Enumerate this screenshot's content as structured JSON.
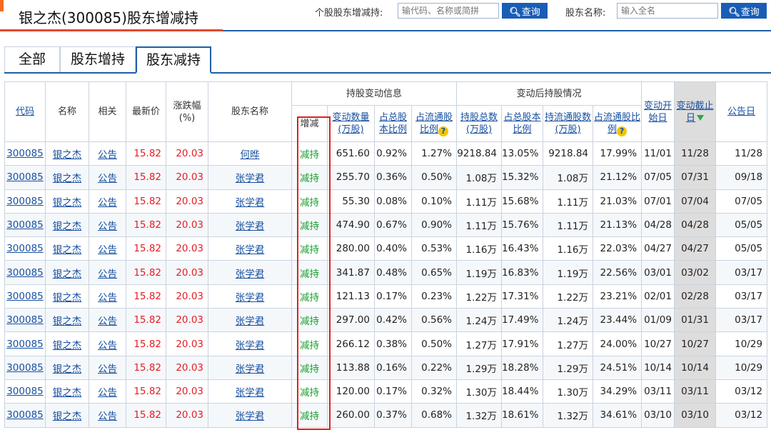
{
  "header": {
    "title": "银之杰(300085)股东增减持",
    "search1_label": "个股股东增减持:",
    "search1_placeholder": "输代码、名称或简拼",
    "search1_button": "查询",
    "search2_label": "股东名称:",
    "search2_placeholder": "输入全名",
    "search2_button": "查询",
    "accent_color": "#e04a2a",
    "brand_blue": "#1f5fa6"
  },
  "tabs": [
    {
      "label": "全部",
      "active": false
    },
    {
      "label": "股东增持",
      "active": false
    },
    {
      "label": "股东减持",
      "active": true
    }
  ],
  "table": {
    "headers": {
      "code": "代码",
      "name": "名称",
      "related": "相关",
      "price": "最新价",
      "change": "涨跌幅(%)",
      "holder": "股东名称",
      "group1": "持股变动信息",
      "group2": "变动后持股情况",
      "direction": "增减",
      "change_qty": "变动数量(万股)",
      "total_ratio": "占总股本比例",
      "float_ratio": "占流通股比例",
      "hold_total": "持股总数(万股)",
      "hold_total_ratio": "占总股本比例",
      "hold_float": "持流通股数(万股)",
      "hold_float_ratio": "占流通股比例",
      "start": "变动开始日",
      "end": "变动截止日",
      "notice": "公告日"
    },
    "rows": [
      {
        "code": "300085",
        "name": "银之杰",
        "related": "公告",
        "price": "15.82",
        "change": "20.03",
        "holder": "何晔",
        "dir": "减持",
        "qty": "651.60",
        "r1": "0.92%",
        "r2": "1.27%",
        "total": "9218.84",
        "r3": "13.05%",
        "float": "9218.84",
        "r4": "17.99%",
        "start": "11/01",
        "end": "11/28",
        "notice": "11/28"
      },
      {
        "code": "300085",
        "name": "银之杰",
        "related": "公告",
        "price": "15.82",
        "change": "20.03",
        "holder": "张学君",
        "dir": "减持",
        "qty": "255.70",
        "r1": "0.36%",
        "r2": "0.50%",
        "total": "1.08万",
        "r3": "15.32%",
        "float": "1.08万",
        "r4": "21.12%",
        "start": "07/05",
        "end": "07/31",
        "notice": "09/18"
      },
      {
        "code": "300085",
        "name": "银之杰",
        "related": "公告",
        "price": "15.82",
        "change": "20.03",
        "holder": "张学君",
        "dir": "减持",
        "qty": "55.30",
        "r1": "0.08%",
        "r2": "0.10%",
        "total": "1.11万",
        "r3": "15.68%",
        "float": "1.11万",
        "r4": "21.03%",
        "start": "07/01",
        "end": "07/04",
        "notice": "07/05"
      },
      {
        "code": "300085",
        "name": "银之杰",
        "related": "公告",
        "price": "15.82",
        "change": "20.03",
        "holder": "张学君",
        "dir": "减持",
        "qty": "474.90",
        "r1": "0.67%",
        "r2": "0.90%",
        "total": "1.11万",
        "r3": "15.76%",
        "float": "1.11万",
        "r4": "21.13%",
        "start": "04/28",
        "end": "04/28",
        "notice": "05/05"
      },
      {
        "code": "300085",
        "name": "银之杰",
        "related": "公告",
        "price": "15.82",
        "change": "20.03",
        "holder": "张学君",
        "dir": "减持",
        "qty": "280.00",
        "r1": "0.40%",
        "r2": "0.53%",
        "total": "1.16万",
        "r3": "16.43%",
        "float": "1.16万",
        "r4": "22.03%",
        "start": "04/27",
        "end": "04/27",
        "notice": "05/05"
      },
      {
        "code": "300085",
        "name": "银之杰",
        "related": "公告",
        "price": "15.82",
        "change": "20.03",
        "holder": "张学君",
        "dir": "减持",
        "qty": "341.87",
        "r1": "0.48%",
        "r2": "0.65%",
        "total": "1.19万",
        "r3": "16.83%",
        "float": "1.19万",
        "r4": "22.56%",
        "start": "03/01",
        "end": "03/02",
        "notice": "03/17"
      },
      {
        "code": "300085",
        "name": "银之杰",
        "related": "公告",
        "price": "15.82",
        "change": "20.03",
        "holder": "张学君",
        "dir": "减持",
        "qty": "121.13",
        "r1": "0.17%",
        "r2": "0.23%",
        "total": "1.22万",
        "r3": "17.31%",
        "float": "1.22万",
        "r4": "23.21%",
        "start": "02/01",
        "end": "02/28",
        "notice": "03/17"
      },
      {
        "code": "300085",
        "name": "银之杰",
        "related": "公告",
        "price": "15.82",
        "change": "20.03",
        "holder": "张学君",
        "dir": "减持",
        "qty": "297.00",
        "r1": "0.42%",
        "r2": "0.56%",
        "total": "1.24万",
        "r3": "17.49%",
        "float": "1.24万",
        "r4": "23.44%",
        "start": "01/09",
        "end": "01/31",
        "notice": "03/17"
      },
      {
        "code": "300085",
        "name": "银之杰",
        "related": "公告",
        "price": "15.82",
        "change": "20.03",
        "holder": "张学君",
        "dir": "减持",
        "qty": "266.12",
        "r1": "0.38%",
        "r2": "0.50%",
        "total": "1.27万",
        "r3": "17.91%",
        "float": "1.27万",
        "r4": "24.00%",
        "start": "10/27",
        "end": "10/27",
        "notice": "10/29"
      },
      {
        "code": "300085",
        "name": "银之杰",
        "related": "公告",
        "price": "15.82",
        "change": "20.03",
        "holder": "张学君",
        "dir": "减持",
        "qty": "113.88",
        "r1": "0.16%",
        "r2": "0.22%",
        "total": "1.29万",
        "r3": "18.28%",
        "float": "1.29万",
        "r4": "24.51%",
        "start": "10/14",
        "end": "10/14",
        "notice": "10/29"
      },
      {
        "code": "300085",
        "name": "银之杰",
        "related": "公告",
        "price": "15.82",
        "change": "20.03",
        "holder": "张学君",
        "dir": "减持",
        "qty": "120.00",
        "r1": "0.17%",
        "r2": "0.32%",
        "total": "1.30万",
        "r3": "18.44%",
        "float": "1.30万",
        "r4": "34.29%",
        "start": "03/11",
        "end": "03/11",
        "notice": "03/12"
      },
      {
        "code": "300085",
        "name": "银之杰",
        "related": "公告",
        "price": "15.82",
        "change": "20.03",
        "holder": "张学君",
        "dir": "减持",
        "qty": "260.00",
        "r1": "0.37%",
        "r2": "0.68%",
        "total": "1.32万",
        "r3": "18.61%",
        "float": "1.32万",
        "r4": "34.61%",
        "start": "03/10",
        "end": "03/10",
        "notice": "03/12"
      }
    ]
  }
}
